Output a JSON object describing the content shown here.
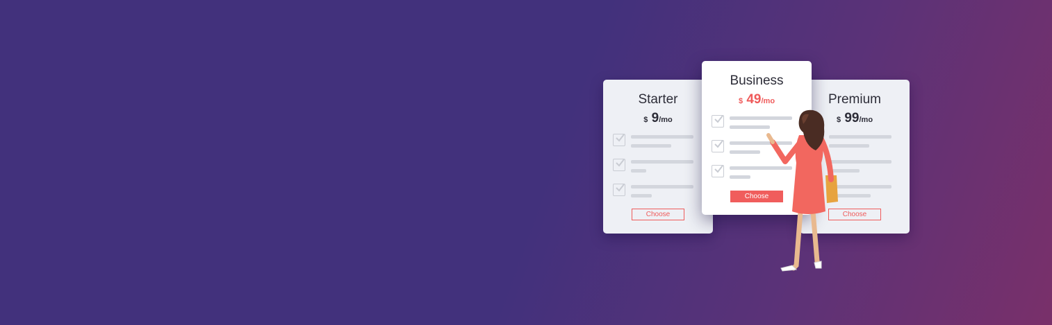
{
  "plans": [
    {
      "name": "Starter",
      "currency": "$",
      "amount": "9",
      "period": "/mo",
      "button": "Choose",
      "features": 3
    },
    {
      "name": "Business",
      "currency": "$",
      "amount": "49",
      "period": "/mo",
      "button": "Choose",
      "features": 3,
      "featured": true
    },
    {
      "name": "Premium",
      "currency": "$",
      "amount": "99",
      "period": "/mo",
      "button": "Choose",
      "features": 3
    }
  ],
  "colors": {
    "accent": "#f05d5c",
    "background_start": "#42317c",
    "background_end": "#79306a",
    "card": "#eef0f5",
    "featured_card": "#ffffff"
  }
}
